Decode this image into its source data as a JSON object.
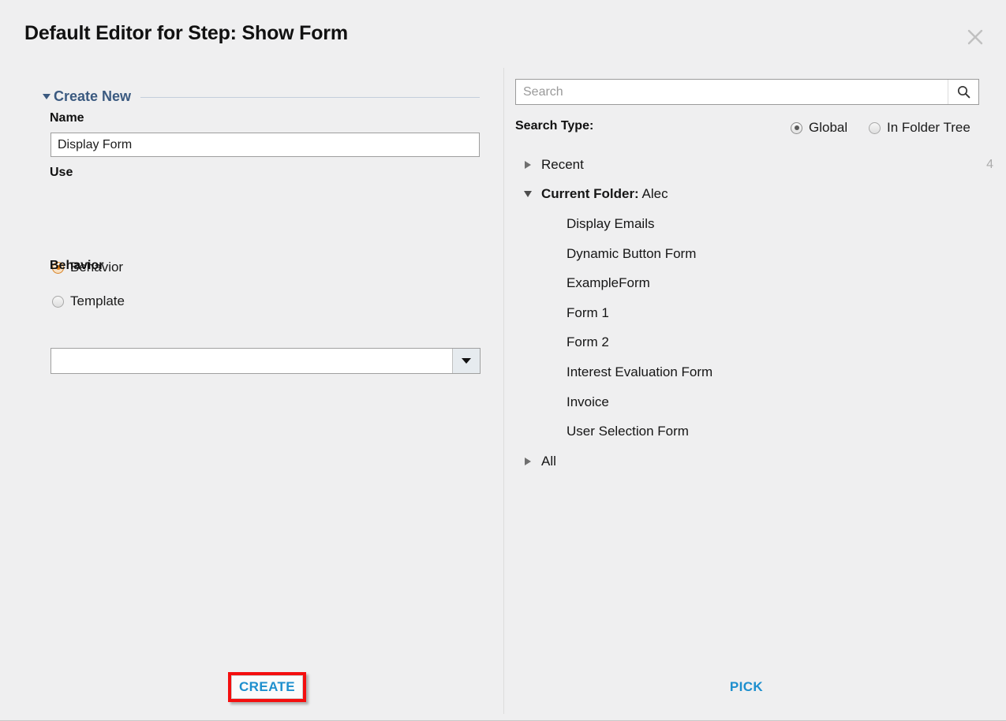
{
  "dialog": {
    "title": "Default Editor for Step: Show Form",
    "close_icon": "close-icon"
  },
  "left_panel": {
    "section": {
      "label": "Create New",
      "expanded": true,
      "twisty_icon": "triangle-down-icon"
    },
    "name": {
      "label": "Name",
      "value": "Display Form",
      "placeholder": ""
    },
    "use": {
      "label": "Use",
      "options": [
        {
          "label": "Behavior",
          "selected": true
        },
        {
          "label": "Template",
          "selected": false
        }
      ]
    },
    "behavior": {
      "label": "Behavior",
      "value": "",
      "placeholder": "",
      "arrow_icon": "chevron-down-icon"
    },
    "create_button": {
      "label": "CREATE",
      "highlight_color": "#f40f0f",
      "text_color": "#1d8fce"
    }
  },
  "right_panel": {
    "search": {
      "placeholder": "Search",
      "value": "",
      "icon": "search-icon"
    },
    "search_type": {
      "label": "Search Type:",
      "options": [
        {
          "label": "Global",
          "selected": true
        },
        {
          "label": "In Folder Tree",
          "selected": false
        }
      ]
    },
    "tree": [
      {
        "label": "Recent",
        "level": 0,
        "twisty": "collapsed",
        "count": "4",
        "bold_prefix": ""
      },
      {
        "label": "Alec",
        "level": 0,
        "twisty": "expanded",
        "count": "",
        "bold_prefix": "Current Folder:"
      },
      {
        "label": "Display Emails",
        "level": 1,
        "twisty": "none",
        "count": "",
        "bold_prefix": ""
      },
      {
        "label": "Dynamic Button Form",
        "level": 1,
        "twisty": "none",
        "count": "",
        "bold_prefix": ""
      },
      {
        "label": "ExampleForm",
        "level": 1,
        "twisty": "none",
        "count": "",
        "bold_prefix": ""
      },
      {
        "label": "Form 1",
        "level": 1,
        "twisty": "none",
        "count": "",
        "bold_prefix": ""
      },
      {
        "label": "Form 2",
        "level": 1,
        "twisty": "none",
        "count": "",
        "bold_prefix": ""
      },
      {
        "label": "Interest Evaluation Form",
        "level": 1,
        "twisty": "none",
        "count": "",
        "bold_prefix": ""
      },
      {
        "label": "Invoice",
        "level": 1,
        "twisty": "none",
        "count": "",
        "bold_prefix": ""
      },
      {
        "label": "User Selection Form",
        "level": 1,
        "twisty": "none",
        "count": "",
        "bold_prefix": ""
      },
      {
        "label": "All",
        "level": 0,
        "twisty": "collapsed",
        "count": "",
        "bold_prefix": ""
      }
    ],
    "pick_button": {
      "label": "PICK",
      "text_color": "#1d8fce"
    }
  }
}
